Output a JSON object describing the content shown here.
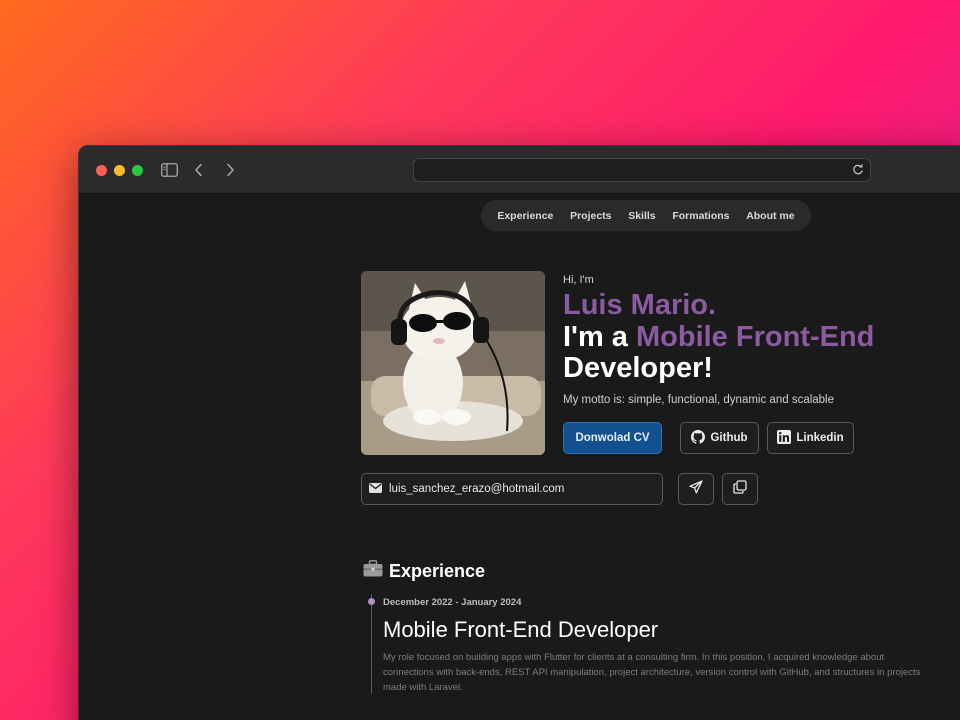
{
  "browser": {
    "url": ""
  },
  "nav": {
    "items": [
      "Experience",
      "Projects",
      "Skills",
      "Formations",
      "About me"
    ]
  },
  "hero": {
    "greeting": "Hi, I'm",
    "name": "Luis Mario.",
    "role_prefix": "I'm a ",
    "role_accent": "Mobile Front-End",
    "role_suffix": "Developer!",
    "motto": "My motto is: simple, functional, dynamic and scalable",
    "cv_button": "Donwolad CV",
    "github_button": "Github",
    "linkedin_button": "Linkedin",
    "email": "luis_sanchez_erazo@hotmail.com"
  },
  "experience": {
    "heading": "Experience",
    "entries": [
      {
        "dates": "December 2022 - January 2024",
        "title": "Mobile Front-End Developer",
        "description": "My role focused on building apps with Flutter for clients at a consulting firm. In this position, I acquired knowledge about connections with back-ends, REST API manipulation, project architecture, version control with GitHub, and structures in projects made with Laravel."
      }
    ]
  },
  "colors": {
    "accent_purple": "#8b5aa0",
    "cv_button_blue": "#12508f",
    "page_background": "#1a1a1b"
  }
}
